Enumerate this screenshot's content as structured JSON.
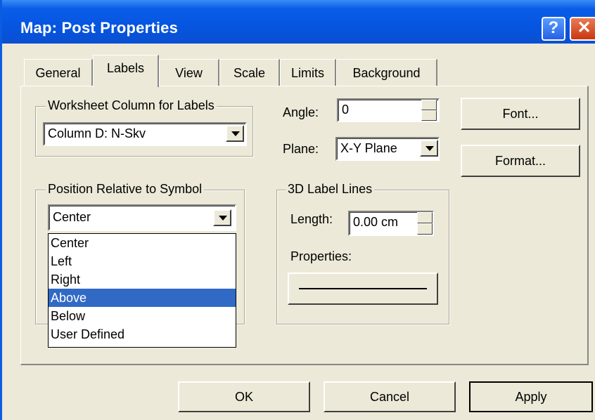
{
  "window": {
    "title": "Map: Post Properties",
    "help_glyph": "?",
    "close_glyph": "✕"
  },
  "tabs": [
    "General",
    "Labels",
    "View",
    "Scale",
    "Limits",
    "Background"
  ],
  "active_tab": "Labels",
  "worksheet_group": {
    "legend": "Worksheet Column for Labels",
    "value": "Column D:  N-Skv"
  },
  "angle": {
    "label": "Angle:",
    "value": "0"
  },
  "plane": {
    "label": "Plane:",
    "value": "X-Y Plane"
  },
  "buttons": {
    "font": "Font...",
    "format": "Format...",
    "ok": "OK",
    "cancel": "Cancel",
    "apply": "Apply"
  },
  "position_group": {
    "legend": "Position Relative to Symbol",
    "value": "Center",
    "options": [
      "Center",
      "Left",
      "Right",
      "Above",
      "Below",
      "User Defined"
    ],
    "highlighted": "Above"
  },
  "label_lines": {
    "legend": "3D Label Lines",
    "length_label": "Length:",
    "length_value": "0.00 cm",
    "properties_label": "Properties:"
  },
  "colors": {
    "title_bar": "#0655e0",
    "dialog_bg": "#ece9d8",
    "selection": "#316ac5"
  }
}
